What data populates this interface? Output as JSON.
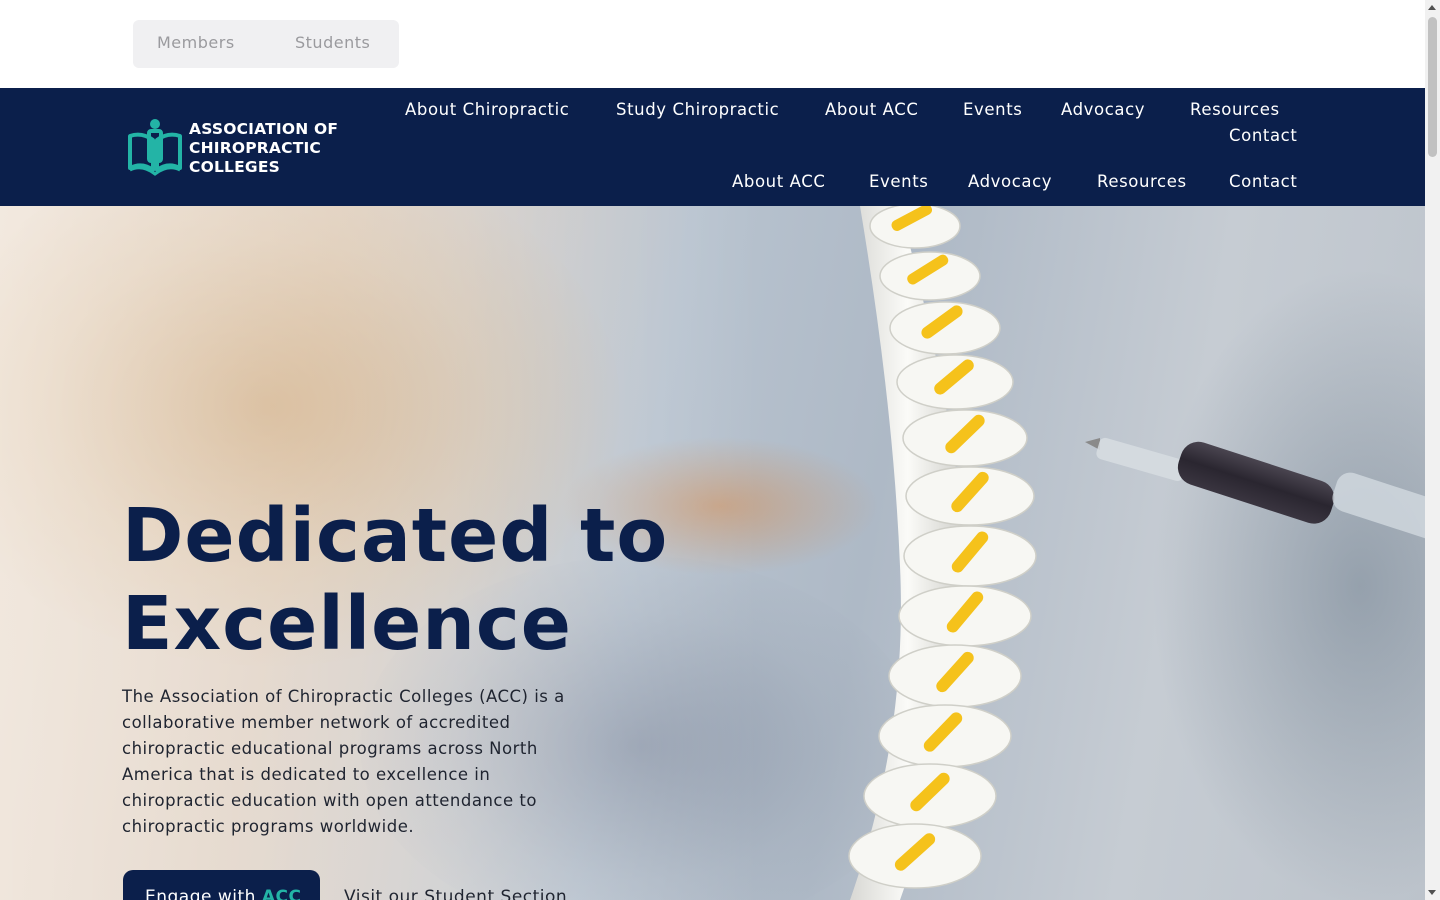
{
  "utility_bar": {
    "members_label": "Members",
    "students_label": "Students"
  },
  "header": {
    "logo": {
      "line1": "ASSOCIATION OF",
      "line2": "CHIROPRACTIC",
      "line3": "COLLEGES",
      "icon": "open-book-person-logo-icon"
    },
    "nav_primary": [
      {
        "label": "About Chiropractic"
      },
      {
        "label": "Study Chiropractic"
      },
      {
        "label": "About ACC"
      },
      {
        "label": "Events"
      },
      {
        "label": "Advocacy"
      },
      {
        "label": "Resources"
      },
      {
        "label": "Contact"
      }
    ],
    "nav_secondary": [
      {
        "label": "About ACC"
      },
      {
        "label": "Events"
      },
      {
        "label": "Advocacy"
      },
      {
        "label": "Resources"
      },
      {
        "label": "Contact"
      }
    ]
  },
  "hero": {
    "title_line1": "Dedicated to",
    "title_line2": "Excellence",
    "body": "The Association of Chiropractic Colleges (ACC) is a collaborative member network of accredited chiropractic educational programs across North America that is dedicated to excellence in chiropractic education with open attendance to chiropractic programs worldwide.",
    "cta_primary_prefix": "Engage with ",
    "cta_primary_accent": "ACC",
    "cta_secondary": "Visit our Student Section"
  },
  "colors": {
    "brand_navy": "#0b1f4b",
    "brand_teal": "#23b4a6",
    "utility_bg": "#f0f0f2"
  }
}
